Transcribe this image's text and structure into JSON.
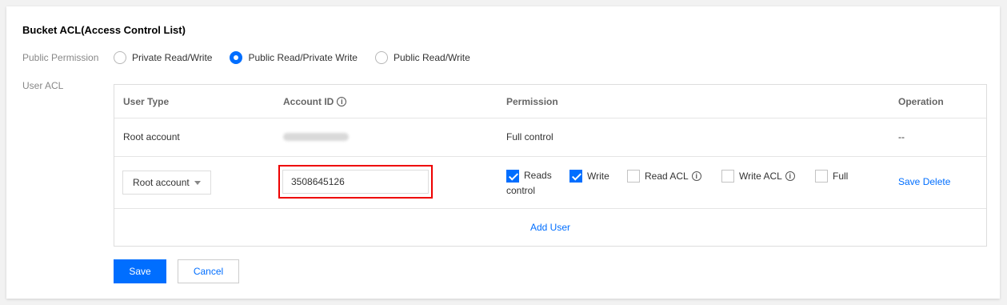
{
  "section": {
    "title": "Bucket ACL(Access Control List)",
    "public_permission_label": "Public Permission",
    "user_acl_label": "User ACL"
  },
  "radios": [
    {
      "label": "Private Read/Write",
      "selected": false
    },
    {
      "label": "Public Read/Private Write",
      "selected": true
    },
    {
      "label": "Public Read/Write",
      "selected": false
    }
  ],
  "table": {
    "headers": {
      "user_type": "User Type",
      "account_id": "Account ID",
      "permission": "Permission",
      "operation": "Operation"
    },
    "root_row": {
      "user_type": "Root account",
      "permission": "Full control",
      "operation": "--"
    },
    "edit_row": {
      "user_type_selected": "Root account",
      "account_id_value": "3508645126",
      "perm_reads": "Reads",
      "perm_reads_cont": "control",
      "perm_write": "Write",
      "perm_read_acl": "Read ACL",
      "perm_write_acl": "Write ACL",
      "perm_full": "Full",
      "save_link": "Save",
      "delete_link": "Delete"
    },
    "add_user": "Add User"
  },
  "buttons": {
    "save": "Save",
    "cancel": "Cancel"
  },
  "colors": {
    "accent": "#006eff",
    "highlight_border": "#e00000"
  }
}
